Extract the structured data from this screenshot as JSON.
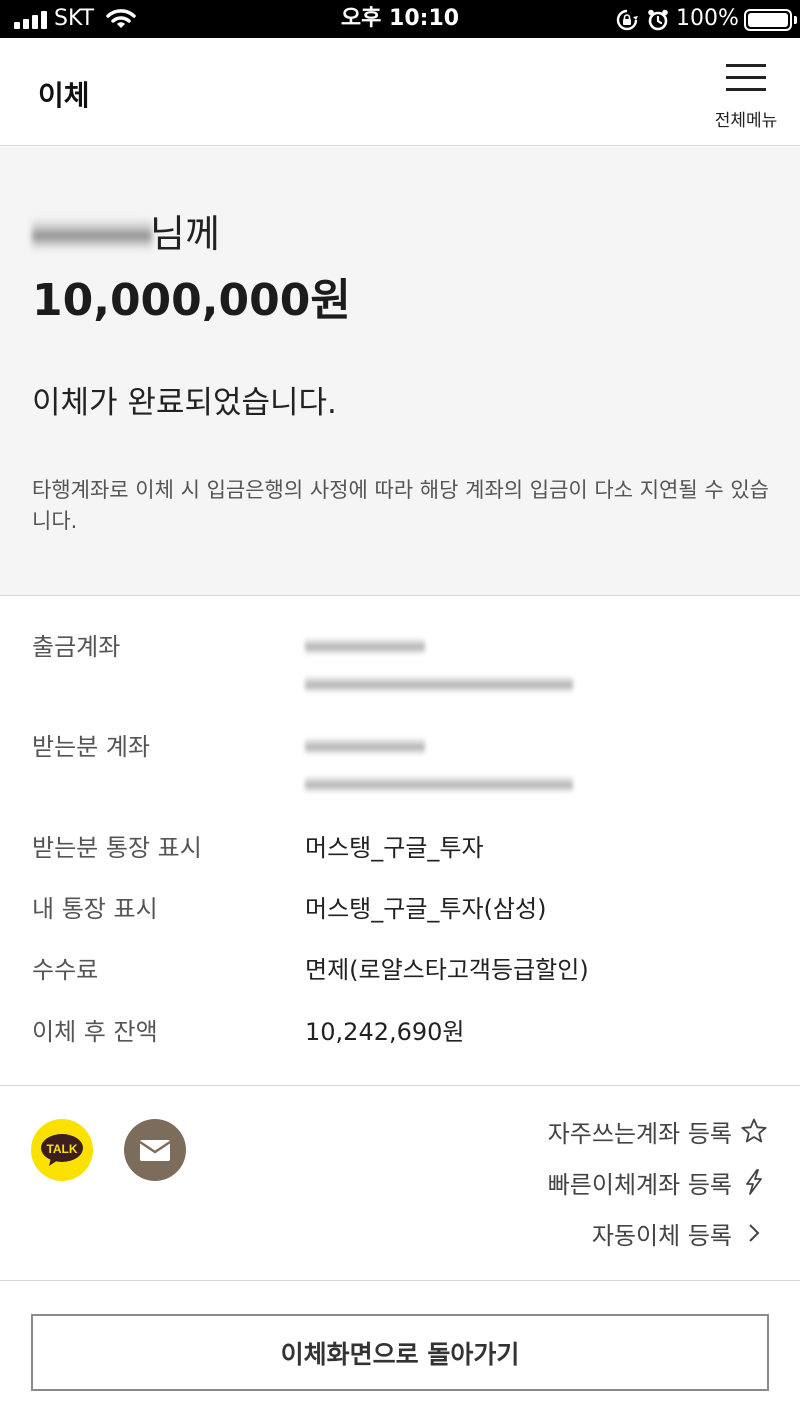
{
  "status_bar": {
    "carrier": "SKT",
    "time": "오후 10:10",
    "battery": "100%"
  },
  "header": {
    "title": "이체",
    "menu_label": "전체메뉴"
  },
  "summary": {
    "recipient_suffix": "님께",
    "amount": "10,000,000원",
    "complete_message": "이체가 완료되었습니다.",
    "notice": "타행계좌로 이체 시 입금은행의 사정에 따라 해당 계좌의 입금이 다소 지연될 수 있습니다."
  },
  "details": {
    "withdraw_account_label": "출금계좌",
    "receiver_account_label": "받는분 계좌",
    "receiver_memo_label": "받는분 통장 표시",
    "receiver_memo_value": "머스탱_구글_투자",
    "my_memo_label": "내 통장 표시",
    "my_memo_value": "머스탱_구글_투자(삼성)",
    "fee_label": "수수료",
    "fee_value": "면제(로얄스타고객등급할인)",
    "balance_label": "이체 후 잔액",
    "balance_value": "10,242,690원"
  },
  "share": {
    "kakao_label": "TALK"
  },
  "links": {
    "favorite": "자주쓰는계좌 등록",
    "quick": "빠른이체계좌 등록",
    "auto": "자동이체 등록"
  },
  "bottom": {
    "back_button": "이체화면으로 돌아가기"
  }
}
